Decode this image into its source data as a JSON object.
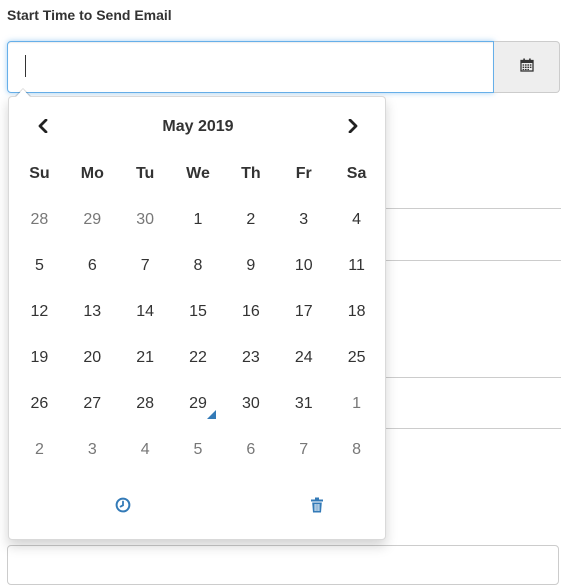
{
  "form": {
    "label": "Start Time to Send Email",
    "input_value": ""
  },
  "icons": {
    "calendar": "calendar-icon",
    "prev": "chevron-left-icon",
    "next": "chevron-right-icon",
    "clock": "clock-icon",
    "clear": "trash-icon"
  },
  "colors": {
    "focus_border": "#66afe9",
    "accent": "#337ab7",
    "muted_day": "#777777"
  },
  "picker": {
    "month_title": "May 2019",
    "weekdays": [
      "Su",
      "Mo",
      "Tu",
      "We",
      "Th",
      "Fr",
      "Sa"
    ],
    "weeks": [
      [
        {
          "d": "28",
          "old": true
        },
        {
          "d": "29",
          "old": true
        },
        {
          "d": "30",
          "old": true
        },
        {
          "d": "1"
        },
        {
          "d": "2"
        },
        {
          "d": "3"
        },
        {
          "d": "4"
        }
      ],
      [
        {
          "d": "5"
        },
        {
          "d": "6"
        },
        {
          "d": "7"
        },
        {
          "d": "8"
        },
        {
          "d": "9"
        },
        {
          "d": "10"
        },
        {
          "d": "11"
        }
      ],
      [
        {
          "d": "12"
        },
        {
          "d": "13"
        },
        {
          "d": "14"
        },
        {
          "d": "15"
        },
        {
          "d": "16"
        },
        {
          "d": "17"
        },
        {
          "d": "18"
        }
      ],
      [
        {
          "d": "19"
        },
        {
          "d": "20"
        },
        {
          "d": "21"
        },
        {
          "d": "22"
        },
        {
          "d": "23"
        },
        {
          "d": "24"
        },
        {
          "d": "25"
        }
      ],
      [
        {
          "d": "26"
        },
        {
          "d": "27"
        },
        {
          "d": "28"
        },
        {
          "d": "29",
          "today": true
        },
        {
          "d": "30"
        },
        {
          "d": "31"
        },
        {
          "d": "1",
          "old": true
        }
      ],
      [
        {
          "d": "2",
          "old": true
        },
        {
          "d": "3",
          "old": true
        },
        {
          "d": "4",
          "old": true
        },
        {
          "d": "5",
          "old": true
        },
        {
          "d": "6",
          "old": true
        },
        {
          "d": "7",
          "old": true
        },
        {
          "d": "8",
          "old": true
        }
      ]
    ]
  }
}
